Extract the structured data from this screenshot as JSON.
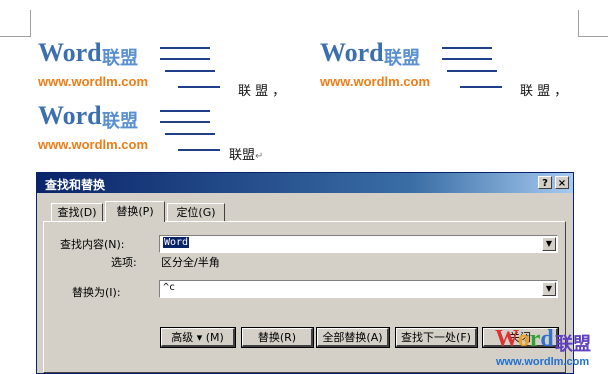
{
  "document": {
    "logo_word": "Word",
    "logo_cn": "联盟",
    "logo_url": "www.wordlm.com",
    "row1_a_text": "联 盟 ，",
    "row1_b_text": "联 盟 ，",
    "row2_text": "联盟",
    "para_mark": "↵"
  },
  "dialog": {
    "title": "查找和替换",
    "help_button": "?",
    "close_button": "×",
    "tabs": [
      {
        "label": "查找(D)",
        "active": false
      },
      {
        "label": "替换(P)",
        "active": true
      },
      {
        "label": "定位(G)",
        "active": false
      }
    ],
    "find_label": "查找内容(N):",
    "find_value": "Word",
    "options_label": "选项:",
    "options_value": "区分全/半角",
    "replace_label": "替换为(I):",
    "replace_value": "^c",
    "buttons": {
      "more": "高级 ▾ (M)",
      "replace": "替换(R)",
      "replace_all": "全部替换(A)",
      "find_next": "查找下一处(F)",
      "close": "关闭"
    }
  },
  "watermark": {
    "word": "Word",
    "cn": "联盟",
    "url": "www.wordlm.com",
    "colors": {
      "w": "#e03030",
      "o": "#f0a020",
      "r": "#30a030",
      "d": "#3070d0"
    }
  }
}
